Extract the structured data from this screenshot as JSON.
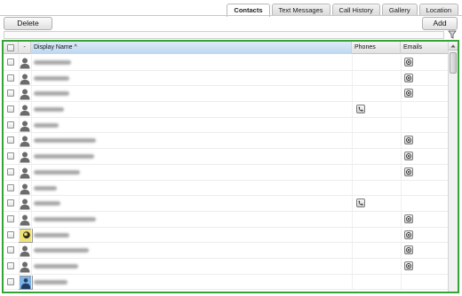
{
  "tabs": [
    "Contacts",
    "Text Messages",
    "Call History",
    "Gallery",
    "Location"
  ],
  "active_tab": "Contacts",
  "toolbar": {
    "delete_label": "Delete",
    "add_label": "Add"
  },
  "columns": {
    "avatar": "-",
    "name": "Display Name ^",
    "phones": "Phones",
    "emails": "Emails"
  },
  "rows": [
    {
      "avatar": "person",
      "phone": false,
      "email": true
    },
    {
      "avatar": "person",
      "phone": false,
      "email": true
    },
    {
      "avatar": "person",
      "phone": false,
      "email": true
    },
    {
      "avatar": "person",
      "phone": true,
      "email": false
    },
    {
      "avatar": "person",
      "phone": false,
      "email": false
    },
    {
      "avatar": "person",
      "phone": false,
      "email": true
    },
    {
      "avatar": "person",
      "phone": false,
      "email": true
    },
    {
      "avatar": "person",
      "phone": false,
      "email": true
    },
    {
      "avatar": "person",
      "phone": false,
      "email": false
    },
    {
      "avatar": "person",
      "phone": true,
      "email": false
    },
    {
      "avatar": "person",
      "phone": false,
      "email": true
    },
    {
      "avatar": "photo",
      "phone": false,
      "email": true
    },
    {
      "avatar": "person",
      "phone": false,
      "email": true
    },
    {
      "avatar": "person",
      "phone": false,
      "email": true
    },
    {
      "avatar": "photo2",
      "phone": false,
      "email": false
    }
  ],
  "colors": {
    "grid_border": "#35a335",
    "sort_header": "#bcd7f0"
  },
  "icons": {
    "filter": "filter-icon",
    "person": "person-icon",
    "phone": "phone-icon",
    "email": "email-icon"
  }
}
